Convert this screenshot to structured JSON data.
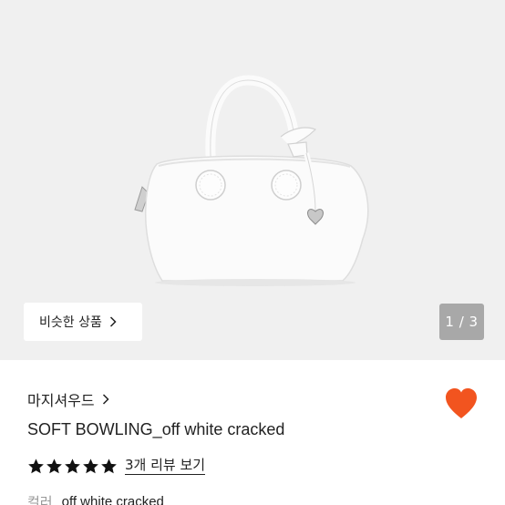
{
  "gallery": {
    "similar_button_label": "비슷한 상품",
    "page_indicator": "1 / 3"
  },
  "shop": {
    "name": "마지셔우드"
  },
  "product": {
    "title": "SOFT BOWLING_off white cracked",
    "rating_stars": 5,
    "reviews_link": "3개 리뷰 보기",
    "option_label": "컬러",
    "option_value": "off white cracked"
  },
  "colors": {
    "heart": "#f2541f",
    "hero_background": "#f0f0f0",
    "indicator_background": "#a8a8a8"
  },
  "icons": {
    "favorite": "heart-icon",
    "chevron": "chevron-right-icon",
    "star": "star-icon"
  }
}
